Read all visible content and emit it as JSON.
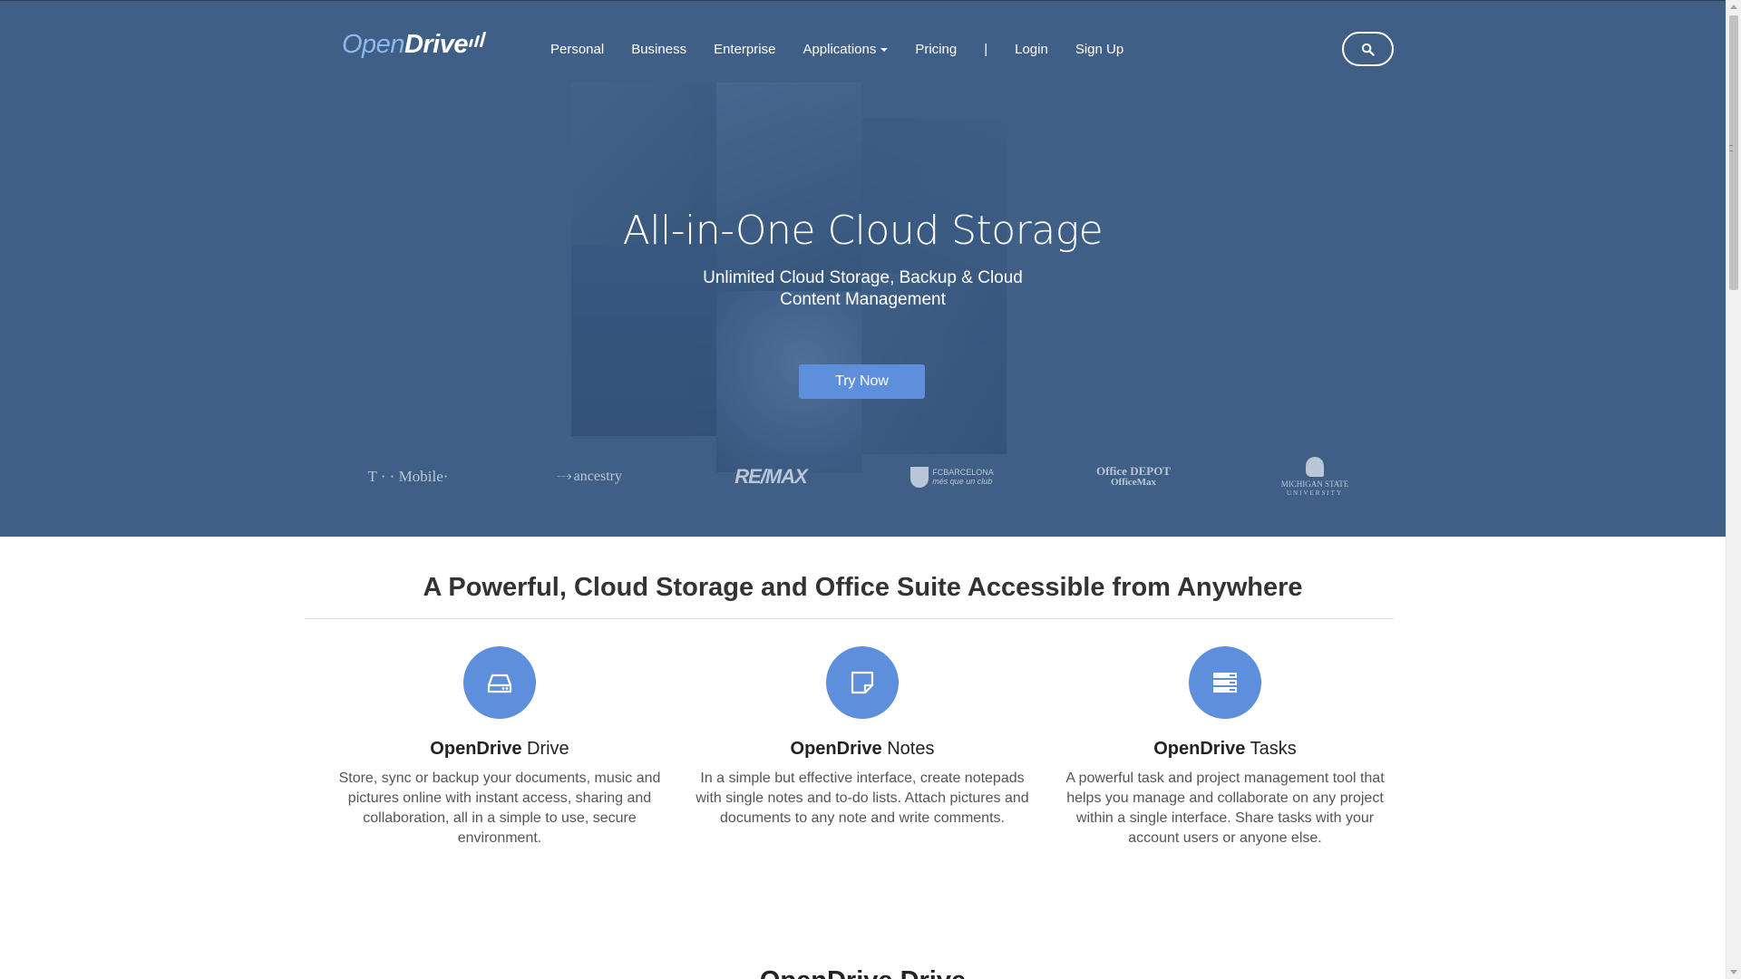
{
  "header": {
    "logo_open": "Open",
    "logo_drive": "Drive",
    "nav": [
      {
        "label": "Personal"
      },
      {
        "label": "Business"
      },
      {
        "label": "Enterprise"
      },
      {
        "label": "Applications"
      },
      {
        "label": "Pricing"
      },
      {
        "label": "|"
      },
      {
        "label": "Login"
      },
      {
        "label": "Sign Up"
      }
    ],
    "search_icon": "search-icon"
  },
  "hero": {
    "title": "All-in-One Cloud Storage",
    "subtitle": "Unlimited Cloud Storage, Backup & Cloud Content Management",
    "cta": "Try Now"
  },
  "partners": {
    "tmobile": "T · · Mobile·",
    "ancestry": "ancestry",
    "remax": "RE/MAX",
    "fcb_line1": "FCBARCELONA",
    "fcb_line2": "més que un club",
    "office_line1": "Office DEPOT",
    "office_line2": "OfficeMax",
    "msu_line1": "MICHIGAN STATE",
    "msu_line2": "UNIVERSITY"
  },
  "features": {
    "title": "A Powerful, Cloud Storage and Office Suite Accessible from Anywhere",
    "items": [
      {
        "brand": "OpenDrive",
        "name": " Drive",
        "icon": "drive-icon",
        "desc": "Store, sync or backup your documents, music and pictures online with instant access, sharing and collaboration, all in a simple to use, secure environment."
      },
      {
        "brand": "OpenDrive",
        "name": " Notes",
        "icon": "note-icon",
        "desc": "In a simple but effective interface, create notepads with single notes and to-do lists. Attach pictures and documents to any note and write comments."
      },
      {
        "brand": "OpenDrive",
        "name": " Tasks",
        "icon": "tasks-icon",
        "desc": "A powerful task and project management tool that helps you manage and collaborate on any project within a single interface. Share tasks with your account users or anyone else."
      }
    ]
  },
  "next_section": {
    "title": "OpenDrive Drive"
  },
  "colors": {
    "hero_bg": "#3f5f86",
    "accent": "#5e8fdd"
  }
}
